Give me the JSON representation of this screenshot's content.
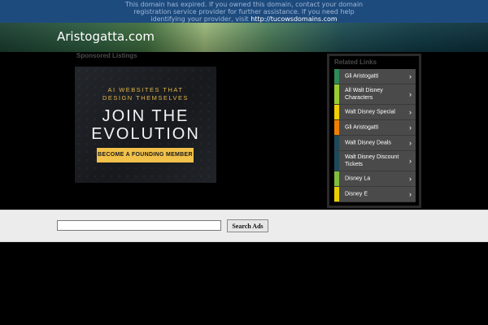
{
  "notice": {
    "text": "This domain has expired. If you owned this domain, contact your domain registration service provider for further assistance. If you need help identifying your provider, visit ",
    "link": "http://tucowsdomains.com"
  },
  "header": {
    "site_title": "Aristogatta.com"
  },
  "sponsored": {
    "label": "Sponsored Listings",
    "ad": {
      "subtitle_line1": "AI WEBSITES THAT",
      "subtitle_line2": "DESIGN THEMSELVES",
      "headline_line1": "JOIN THE",
      "headline_line2": "EVOLUTION",
      "cta": "BECOME A FOUNDING MEMBER"
    }
  },
  "related": {
    "label": "Related Links",
    "links": [
      {
        "label": "Gli Aristogatti",
        "color": "#2e8b57"
      },
      {
        "label": "All Walt Disney Characters",
        "color": "#9acd32"
      },
      {
        "label": "Walt Disney Special",
        "color": "#f0d000"
      },
      {
        "label": "Gli Aristogatti",
        "color": "#f07f00"
      },
      {
        "label": "Walt Disney Deals",
        "color": "#1d4a5a"
      },
      {
        "label": "Walt Disney Discount Tickets",
        "color": "#1d4a5a"
      },
      {
        "label": "Disney La",
        "color": "#7fbf3f"
      },
      {
        "label": "Disney E",
        "color": "#e8d000"
      }
    ]
  },
  "search": {
    "value": "",
    "button": "Search Ads"
  }
}
